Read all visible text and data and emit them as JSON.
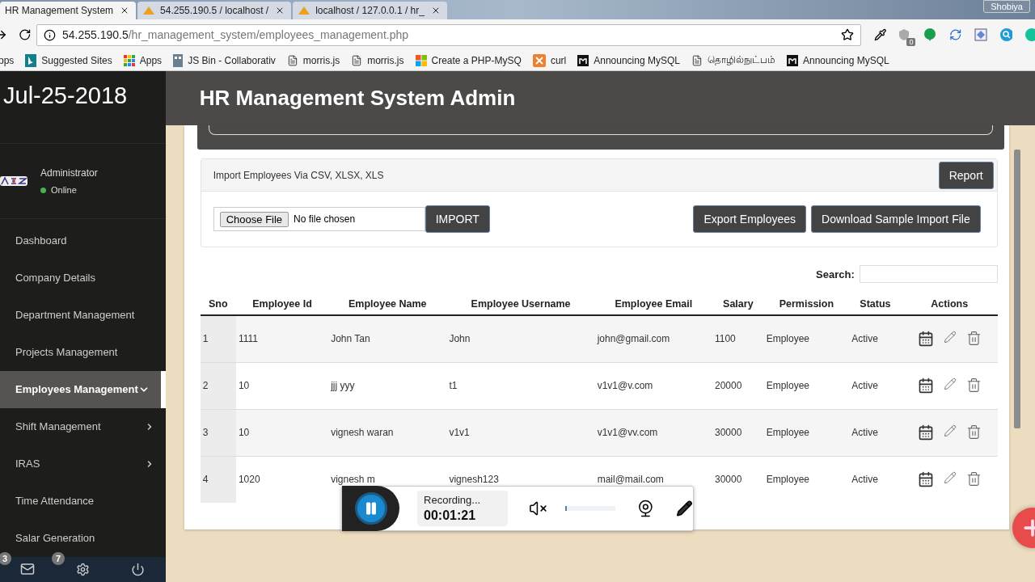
{
  "browser": {
    "tabs": [
      {
        "title": "HR Management System",
        "selected": true
      },
      {
        "title": "54.255.190.5 / localhost /",
        "selected": false
      },
      {
        "title": "localhost / 127.0.0.1 / hr_",
        "selected": false
      }
    ],
    "profile": "Shobiya",
    "url": {
      "host": "54.255.190.5",
      "path": "/hr_management_system/employees_management.php"
    },
    "extension_badge": "0",
    "bookmarks": [
      {
        "label": "pps",
        "kind": "none"
      },
      {
        "label": "Suggested Sites",
        "kind": "bing"
      },
      {
        "label": "Apps",
        "kind": "grid"
      },
      {
        "label": "JS Bin - Collaborativ",
        "kind": "jsbin"
      },
      {
        "label": "morris.js",
        "kind": "page"
      },
      {
        "label": "morris.js",
        "kind": "page"
      },
      {
        "label": "Create a PHP-MySQ",
        "kind": "windows"
      },
      {
        "label": "curl",
        "kind": "xampp"
      },
      {
        "label": "Announcing MySQL",
        "kind": "m"
      },
      {
        "label": "தொழில்நுட்பம்",
        "kind": "page"
      },
      {
        "label": "Announcing MySQL",
        "kind": "m"
      }
    ]
  },
  "sidebar": {
    "date": "Jul-25-2018",
    "user": {
      "name": "Administrator",
      "status": "Online"
    },
    "items": [
      {
        "label": "Dashboard",
        "selected": false,
        "kind": "link"
      },
      {
        "label": "Company Details",
        "selected": false,
        "kind": "link"
      },
      {
        "label": "Department Management",
        "selected": false,
        "kind": "link"
      },
      {
        "label": "Projects Management",
        "selected": false,
        "kind": "link"
      },
      {
        "label": "Employees Management",
        "selected": true,
        "kind": "group",
        "expanded": true
      },
      {
        "label": "Shift Management",
        "selected": false,
        "kind": "group",
        "expanded": false
      },
      {
        "label": "IRAS",
        "selected": false,
        "kind": "group",
        "expanded": false
      },
      {
        "label": "Time Attendance",
        "selected": false,
        "kind": "link"
      },
      {
        "label": "Salar Generation",
        "selected": false,
        "kind": "link"
      }
    ],
    "footer_badges": [
      "3",
      "7"
    ]
  },
  "header": {
    "title": "HR Management System Admin"
  },
  "import": {
    "title": "Import Employees Via CSV, XLSX, XLS",
    "report_button": "Report",
    "choose_button": "Choose File",
    "file_status": "No file chosen",
    "import_button": "IMPORT",
    "buttons": [
      "Export Employees",
      "Download Sample Import File"
    ]
  },
  "search": {
    "label": "Search:"
  },
  "table": {
    "columns": [
      "Sno",
      "Employee Id",
      "Employee Name",
      "Employee Username",
      "Employee Email",
      "Salary",
      "Permission",
      "Status",
      "Actions"
    ],
    "rows": [
      [
        "1",
        "1111",
        "John Tan",
        "John",
        "john@gmail.com",
        "1100",
        "Employee",
        "Active"
      ],
      [
        "2",
        "10",
        "jjj yyy",
        "t1",
        "v1v1@v.com",
        "20000",
        "Employee",
        "Active"
      ],
      [
        "3",
        "10",
        "vignesh waran",
        "v1v1",
        "v1v1@vv.com",
        "30000",
        "Employee",
        "Active"
      ],
      [
        "4",
        "1020",
        "vignesh m",
        "vignesh123",
        "mail@mail.com",
        "30000",
        "Employee",
        "Active"
      ]
    ]
  },
  "recorder": {
    "status": "Recording...",
    "time": "00:01:21",
    "volume": {
      "level": 0.02
    }
  }
}
